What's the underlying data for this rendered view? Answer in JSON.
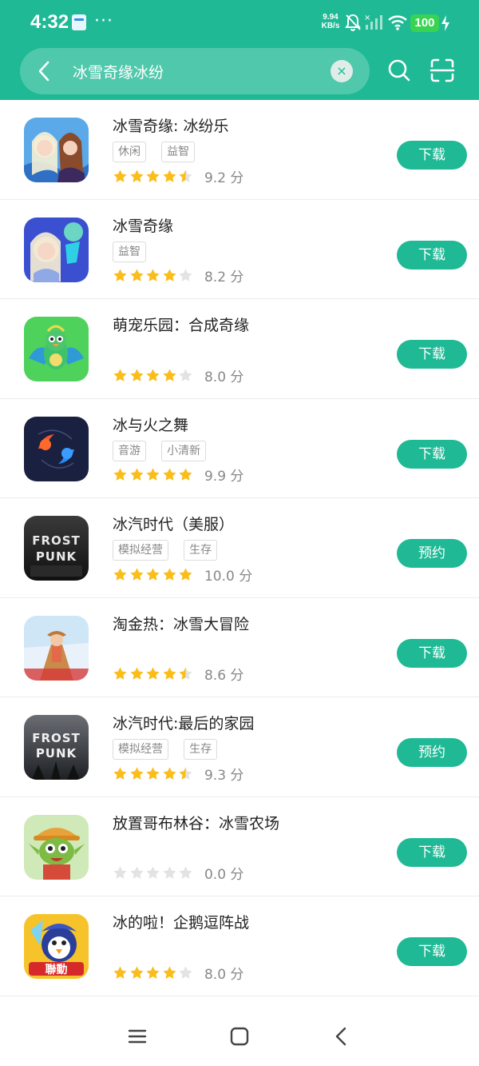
{
  "status_bar": {
    "time": "4:32",
    "more": "···",
    "net_speed_value": "9.94",
    "net_speed_unit": "KB/s",
    "battery": "100"
  },
  "search": {
    "query": "冰雪奇缘冰纷",
    "clear_label": "×"
  },
  "colors": {
    "accent": "#1fb995",
    "star_filled": "#fbbd1a",
    "star_empty": "#e3e3e3"
  },
  "apps": [
    {
      "title": "冰雪奇缘: 冰纷乐",
      "tags": [
        "休闲",
        "益智"
      ],
      "stars": 4.5,
      "score": "9.2 分",
      "action": "下载"
    },
    {
      "title": "冰雪奇缘",
      "tags": [
        "益智"
      ],
      "stars": 4,
      "score": "8.2 分",
      "action": "下载"
    },
    {
      "title": "萌宠乐园：合成奇缘",
      "tags": [],
      "stars": 4,
      "score": "8.0 分",
      "action": "下载"
    },
    {
      "title": "冰与火之舞",
      "tags": [
        "音游",
        "小清新"
      ],
      "stars": 5,
      "score": "9.9 分",
      "action": "下载"
    },
    {
      "title": "冰汽时代（美服）",
      "tags": [
        "模拟经营",
        "生存"
      ],
      "stars": 5,
      "score": "10.0 分",
      "action": "预约"
    },
    {
      "title": "淘金热：冰雪大冒险",
      "tags": [],
      "stars": 4.5,
      "score": "8.6 分",
      "action": "下载"
    },
    {
      "title": "冰汽时代:最后的家园",
      "tags": [
        "模拟经营",
        "生存"
      ],
      "stars": 4.5,
      "score": "9.3 分",
      "action": "预约"
    },
    {
      "title": "放置哥布林谷：冰雪农场",
      "tags": [],
      "stars": 0,
      "score": "0.0 分",
      "action": "下载"
    },
    {
      "title": "冰的啦！企鹅逗阵战",
      "tags": [],
      "stars": 4,
      "score": "8.0 分",
      "action": "下载"
    }
  ],
  "icon_texts": {
    "frostpunk": "FROST PUNK",
    "lianyi": "聯動"
  }
}
